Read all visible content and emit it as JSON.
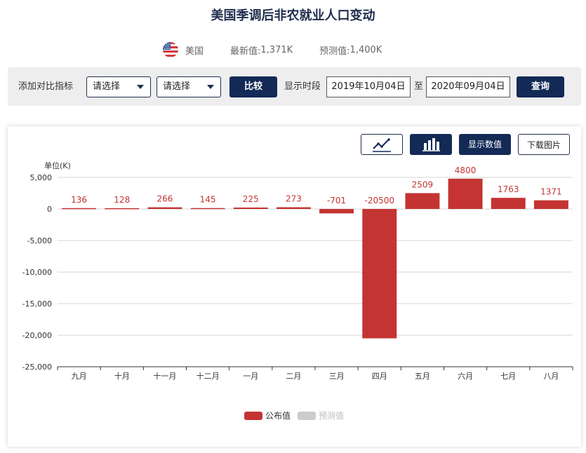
{
  "header": {
    "title": "美国季调后非农就业人口变动"
  },
  "summary": {
    "country": "美国",
    "latest_label": "最新值:",
    "latest_value": "1,371K",
    "forecast_label": "预测值:",
    "forecast_value": "1,400K"
  },
  "filter": {
    "compare_label": "添加对比指标",
    "select1": "请选择",
    "select2": "请选择",
    "compare_button": "比较",
    "period_label": "显示时段",
    "start_date": "2019年10月04日",
    "to_label": "至",
    "end_date": "2020年09月04日",
    "query_button": "查询"
  },
  "toolbar": {
    "show_values": "显示数值",
    "download": "下载图片"
  },
  "chart_data": {
    "type": "bar",
    "ylabel": "单位(K)",
    "ylim": [
      -25000,
      5000
    ],
    "yticks": [
      5000,
      0,
      -5000,
      -10000,
      -15000,
      -20000,
      -25000
    ],
    "ytick_labels": [
      "5,000",
      "0",
      "-5,000",
      "-10,000",
      "-15,000",
      "-20,000",
      "-25,000"
    ],
    "categories": [
      "九月",
      "十月",
      "十一月",
      "十二月",
      "一月",
      "二月",
      "三月",
      "四月",
      "五月",
      "六月",
      "七月",
      "八月"
    ],
    "series": [
      {
        "name": "公布值",
        "color": "#c33432",
        "values": [
          136,
          128,
          266,
          145,
          225,
          273,
          -701,
          -20500,
          2509,
          4800,
          1763,
          1371
        ]
      }
    ],
    "legend": [
      {
        "name": "公布值",
        "color": "#c33432",
        "active": true
      },
      {
        "name": "预测值",
        "color": "#cccccc",
        "active": false
      }
    ],
    "grid": true,
    "legend_position": "bottom-center"
  }
}
